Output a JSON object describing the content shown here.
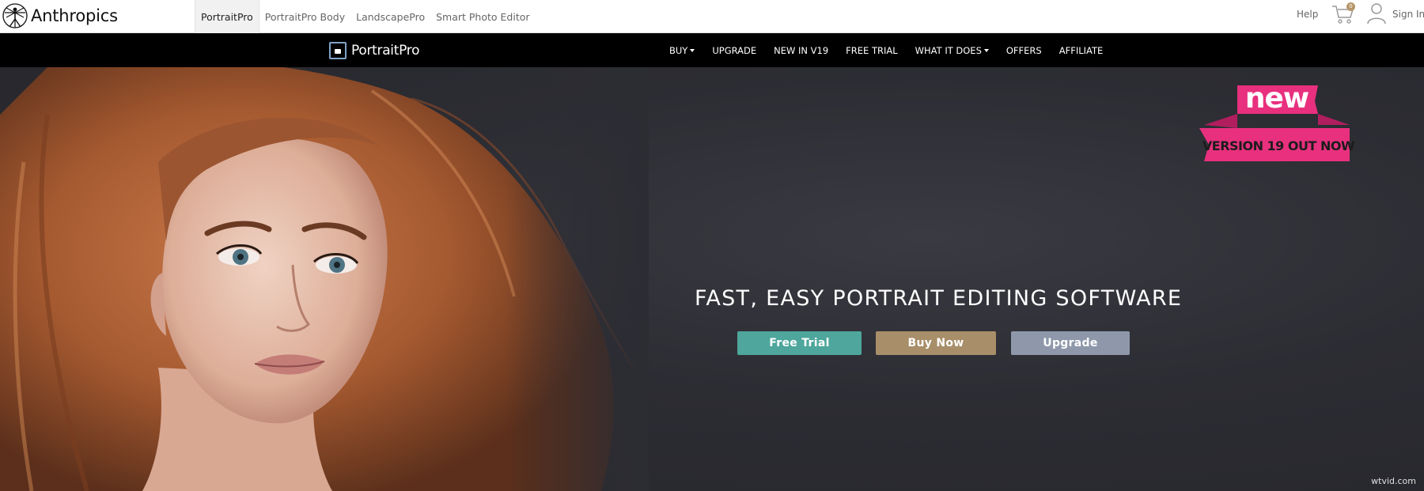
{
  "brand": {
    "name": "Anthropics"
  },
  "product_tabs": [
    {
      "label": "PortraitPro",
      "active": true
    },
    {
      "label": "PortraitPro Body",
      "active": false
    },
    {
      "label": "LandscapePro",
      "active": false
    },
    {
      "label": "Smart Photo Editor",
      "active": false
    }
  ],
  "utility": {
    "help": "Help",
    "cart_count": "0",
    "sign_in": "Sign In",
    "cart_icon": "shopping-cart-icon",
    "user_icon": "user-icon"
  },
  "navbar": {
    "logo_text": "PortraitPro",
    "items": [
      {
        "label": "BUY",
        "dropdown": true
      },
      {
        "label": "UPGRADE",
        "dropdown": false
      },
      {
        "label": "NEW IN V19",
        "dropdown": false
      },
      {
        "label": "FREE TRIAL",
        "dropdown": false
      },
      {
        "label": "WHAT IT DOES",
        "dropdown": true
      },
      {
        "label": "OFFERS",
        "dropdown": false
      },
      {
        "label": "AFFILIATE",
        "dropdown": false
      }
    ]
  },
  "hero": {
    "headline": "FAST, EASY PORTRAIT EDITING SOFTWARE",
    "buttons": {
      "free_trial": "Free Trial",
      "buy_now": "Buy Now",
      "upgrade": "Upgrade"
    },
    "badge_top": "new",
    "badge_bottom": "VERSION 19 OUT NOW"
  },
  "watermark": "wtvid.com",
  "colors": {
    "free_trial": "#4ea69c",
    "buy_now": "#a88e69",
    "upgrade": "#8e98aa",
    "badge_pink": "#e8307e",
    "nav_bg": "#000000",
    "hero_bg": "#2c2b30"
  }
}
